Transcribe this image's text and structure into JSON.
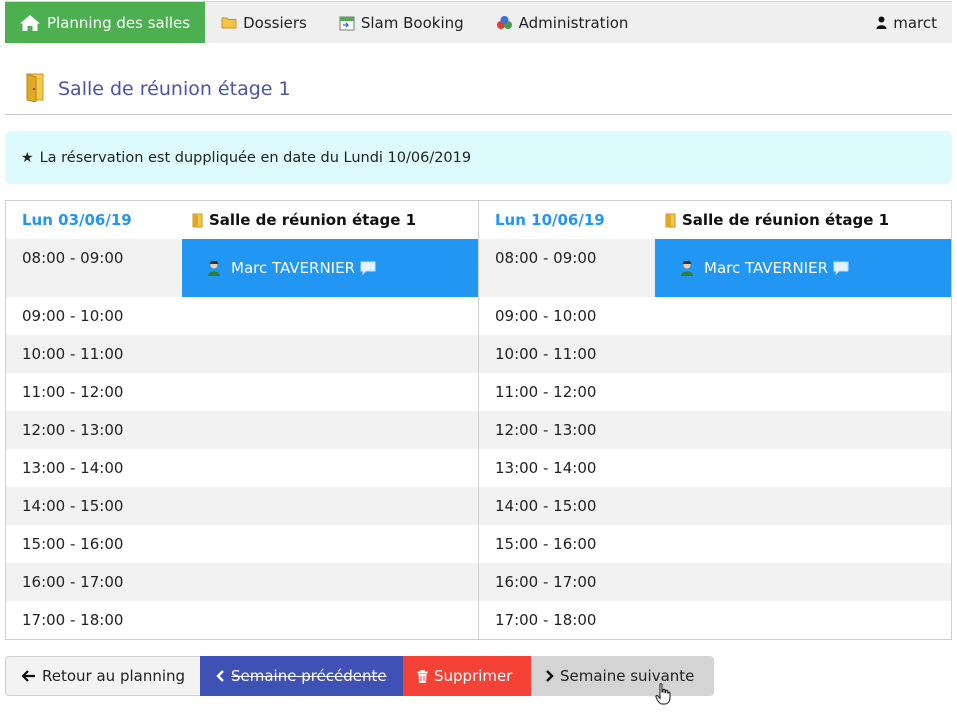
{
  "navbar": {
    "items": [
      {
        "label": "Planning des salles",
        "icon": "home-icon"
      },
      {
        "label": "Dossiers",
        "icon": "folder-icon"
      },
      {
        "label": "Slam Booking",
        "icon": "calendar-icon"
      },
      {
        "label": "Administration",
        "icon": "admin-icon"
      }
    ],
    "user": {
      "label": "marct",
      "icon": "user-icon"
    },
    "active_color": "#4caf50"
  },
  "page": {
    "title": "Salle de réunion étage 1",
    "title_color": "#4b55a8"
  },
  "alert": {
    "text": "La réservation est duppliquée en date du Lundi 10/06/2019",
    "icon": "star-icon",
    "background": "#ddfbfc"
  },
  "days": [
    {
      "date": "Lun 03/06/19",
      "room": "Salle de réunion étage 1",
      "slots": [
        "08:00 - 09:00",
        "09:00 - 10:00",
        "10:00 - 11:00",
        "11:00 - 12:00",
        "12:00 - 13:00",
        "13:00 - 14:00",
        "14:00 - 15:00",
        "15:00 - 16:00",
        "16:00 - 17:00",
        "17:00 - 18:00"
      ],
      "booking": {
        "slot": "08:00 - 09:00",
        "name": "Marc TAVERNIER"
      }
    },
    {
      "date": "Lun 10/06/19",
      "room": "Salle de réunion étage 1",
      "slots": [
        "08:00 - 09:00",
        "09:00 - 10:00",
        "10:00 - 11:00",
        "11:00 - 12:00",
        "12:00 - 13:00",
        "13:00 - 14:00",
        "14:00 - 15:00",
        "15:00 - 16:00",
        "16:00 - 17:00",
        "17:00 - 18:00"
      ],
      "booking": {
        "slot": "08:00 - 09:00",
        "name": "Marc TAVERNIER"
      }
    }
  ],
  "colors": {
    "date": "#2196f3",
    "booking": "#2196f3",
    "prev_button": "#3f51b5",
    "delete_button": "#f44336",
    "next_button": "#d4d4d4"
  },
  "buttons": {
    "back": "Retour au planning",
    "prev": "Semaine précédente",
    "delete": "Supprimer",
    "next": "Semaine suivante"
  }
}
